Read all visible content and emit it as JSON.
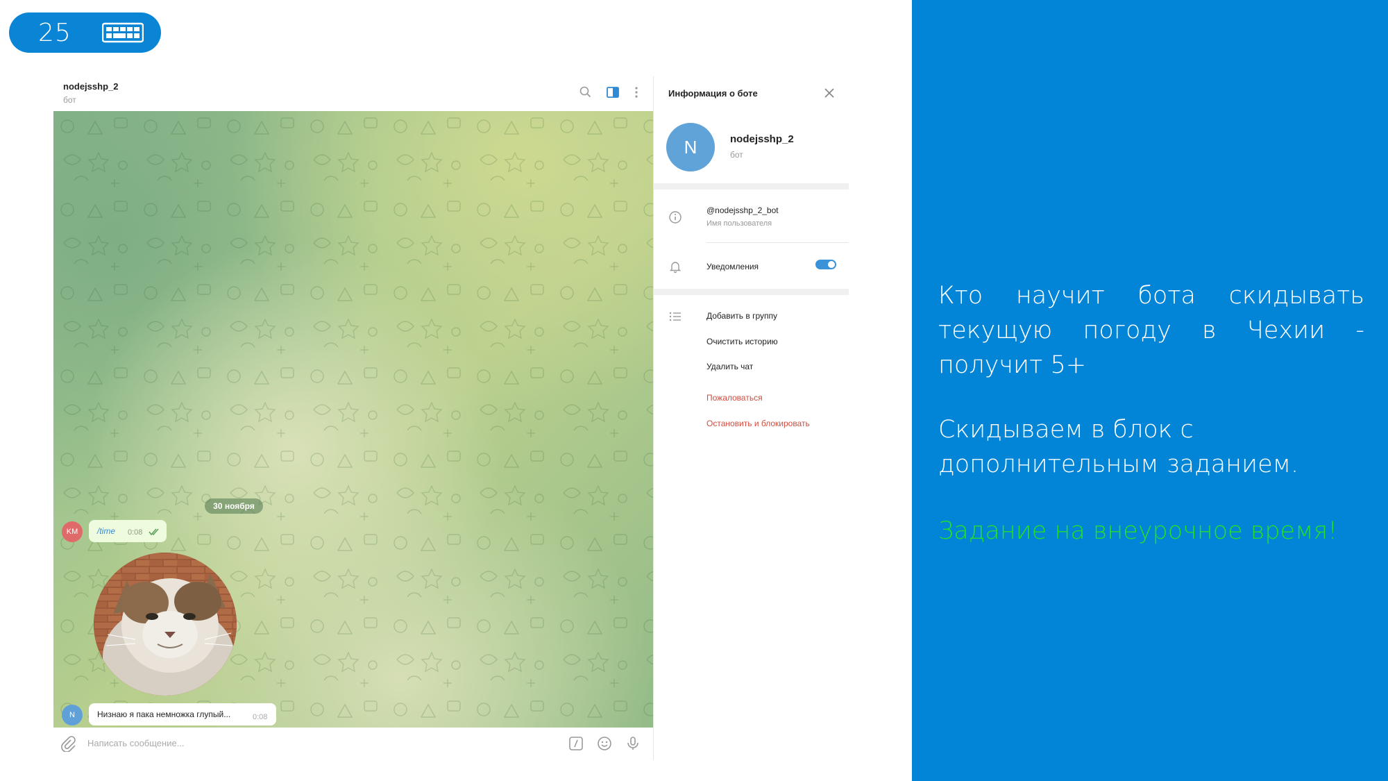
{
  "slide": {
    "number": "25",
    "keyboard_icon": "keyboard-icon"
  },
  "panel": {
    "text1": "Кто научит бота скидывать текущую погоду в Чехии - получит 5+",
    "text2": "Скидываем в блок с дополнительным заданием.",
    "text3": "Задание на внеурочное время!",
    "bg_color": "#0285d6",
    "highlight_color": "#23e02a"
  },
  "chat": {
    "title": "nodejsshp_2",
    "subtitle": "бот",
    "date_badge": "30 ноября",
    "messages": [
      {
        "author_initials": "KM",
        "text": "/time",
        "time": "0:08",
        "read": true
      },
      {
        "author_initials": "N",
        "text": "Низнаю я пака немножка глупый...",
        "time": "0:08"
      }
    ],
    "compose_placeholder": "Написать сообщение..."
  },
  "info": {
    "title": "Информация о боте",
    "avatar_letter": "N",
    "name": "nodejsshp_2",
    "subtitle": "бот",
    "username": "@nodejsshp_2_bot",
    "username_label": "Имя пользователя",
    "notifications_label": "Уведомления",
    "notifications_on": true,
    "actions": [
      "Добавить в группу",
      "Очистить историю",
      "Удалить чат"
    ],
    "danger_actions": [
      "Пожаловаться",
      "Остановить и блокировать"
    ]
  }
}
